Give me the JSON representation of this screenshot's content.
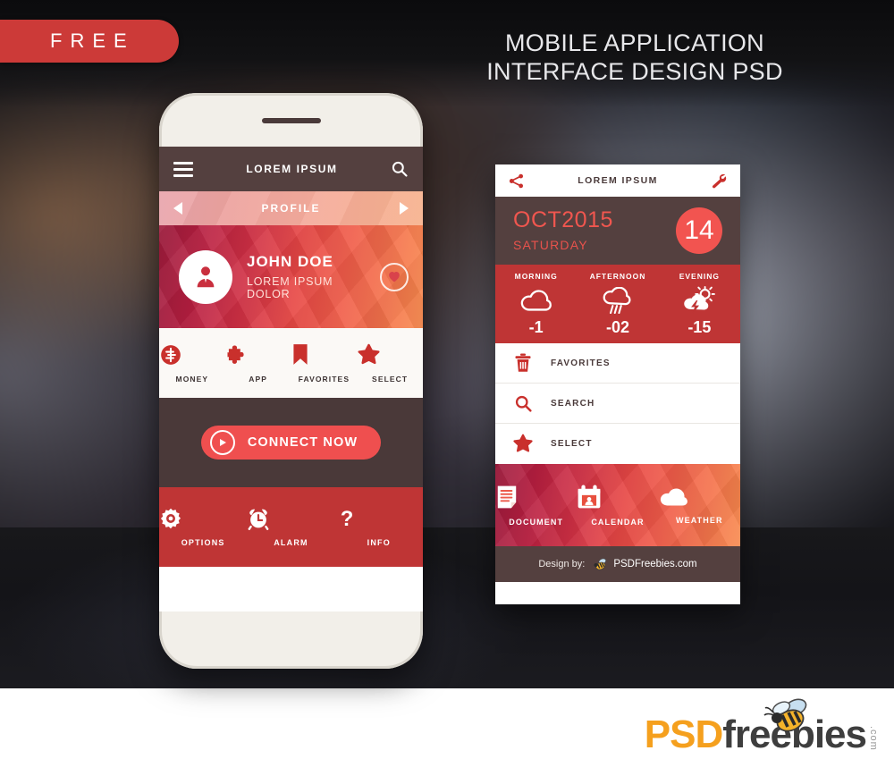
{
  "promo": {
    "badge_label": "FREE",
    "headline_line1": "MOBILE APPLICATION",
    "headline_line2": "INTERFACE DESIGN PSD",
    "accent_red": "#cc3a38",
    "dark_brown": "#54403f",
    "coral": "#ef4f4f"
  },
  "phone_screen": {
    "header": {
      "title": "LOREM IPSUM",
      "menu_icon": "hamburger-icon",
      "search_icon": "search-icon"
    },
    "profile_bar": {
      "label": "PROFILE",
      "prev_icon": "triangle-left-icon",
      "next_icon": "triangle-right-icon"
    },
    "profile_card": {
      "name": "JOHN DOE",
      "subtitle": "LOREM IPSUM DOLOR",
      "avatar_icon": "user-avatar-icon",
      "favorite_icon": "heart-icon"
    },
    "quick_icons": [
      {
        "label": "MONEY",
        "icon": "dollar-circle-icon"
      },
      {
        "label": "APP",
        "icon": "puzzle-piece-icon"
      },
      {
        "label": "FAVORITES",
        "icon": "bookmark-icon"
      },
      {
        "label": "SELECT",
        "icon": "star-icon"
      }
    ],
    "connect": {
      "label": "CONNECT NOW",
      "icon": "play-circle-icon"
    },
    "bottom_nav": [
      {
        "label": "OPTIONS",
        "icon": "gear-icon"
      },
      {
        "label": "ALARM",
        "icon": "alarm-clock-icon"
      },
      {
        "label": "INFO",
        "icon": "question-mark-icon"
      }
    ]
  },
  "second_screen": {
    "header": {
      "title": "LOREM IPSUM",
      "share_icon": "share-icon",
      "settings_icon": "wrench-icon"
    },
    "calendar": {
      "month_year": "OCT2015",
      "weekday": "SATURDAY",
      "day_number": "14"
    },
    "weather": [
      {
        "label": "MORNING",
        "icon": "cloud-icon",
        "value": "-1"
      },
      {
        "label": "AFTERNOON",
        "icon": "rain-cloud-icon",
        "value": "-02"
      },
      {
        "label": "EVENING",
        "icon": "storm-sun-icon",
        "value": "-15"
      }
    ],
    "list": [
      {
        "label": "FAVORITES",
        "icon": "trash-icon"
      },
      {
        "label": "SEARCH",
        "icon": "search-icon"
      },
      {
        "label": "SELECT",
        "icon": "star-icon"
      }
    ],
    "tiles": [
      {
        "label": "DOCUMENT",
        "icon": "document-icon"
      },
      {
        "label": "CALENDAR",
        "icon": "calendar-icon"
      },
      {
        "label": "WEATHER",
        "icon": "cloud-icon"
      }
    ],
    "footer": {
      "prefix": "Design by:",
      "brand": "PSDFreebies.com",
      "bee_icon": "bee-icon"
    }
  },
  "site_logo": {
    "part1": "PSD",
    "part2": "freebies",
    "part3": ".com",
    "bee_icon": "bee-icon",
    "color1": "#f5a01e",
    "color2": "#3e3e3e"
  }
}
